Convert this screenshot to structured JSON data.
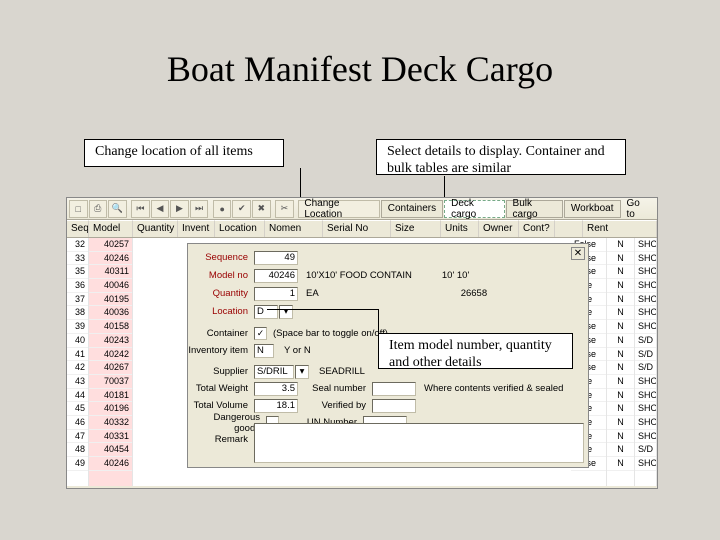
{
  "title": "Boat Manifest Deck Cargo",
  "callouts": {
    "change_location": "Change location of all items",
    "select_details": "Select details to display. Container and bulk tables are similar",
    "item_details": "Item model number, quantity and other details"
  },
  "toolbar": {
    "change_location_btn": "Change Location",
    "tabs": [
      "Containers",
      "Deck cargo",
      "Bulk cargo",
      "Workboat"
    ],
    "goto": "Go to"
  },
  "grid": {
    "headers": [
      "Seq",
      "Model",
      "Quantity",
      "Invent",
      "Location",
      "Nomen",
      "Serial No",
      "Size",
      "Units",
      "Owner",
      "Cont?",
      "",
      "Rent"
    ],
    "rows": [
      {
        "seq": "32",
        "model": "40257",
        "cont": "False",
        "own": "N",
        "rent": "SHO"
      },
      {
        "seq": "33",
        "model": "40246",
        "cont": "False",
        "own": "N",
        "rent": "SHO"
      },
      {
        "seq": "35",
        "model": "40311",
        "cont": "False",
        "own": "N",
        "rent": "SHO"
      },
      {
        "seq": "36",
        "model": "40046",
        "cont": "True",
        "own": "N",
        "rent": "SHO"
      },
      {
        "seq": "37",
        "model": "40195",
        "cont": "True",
        "own": "N",
        "rent": "SHO"
      },
      {
        "seq": "38",
        "model": "40036",
        "cont": "True",
        "own": "N",
        "rent": "SHO"
      },
      {
        "seq": "39",
        "model": "40158",
        "cont": "False",
        "own": "N",
        "rent": "SHO"
      },
      {
        "seq": "40",
        "model": "40243",
        "cont": "False",
        "own": "N",
        "rent": "S/D"
      },
      {
        "seq": "41",
        "model": "40242",
        "cont": "False",
        "own": "N",
        "rent": "S/D"
      },
      {
        "seq": "42",
        "model": "40267",
        "cont": "False",
        "own": "N",
        "rent": "S/D"
      },
      {
        "seq": "43",
        "model": "70037",
        "cont": "True",
        "own": "N",
        "rent": "SHO"
      },
      {
        "seq": "44",
        "model": "40181",
        "cont": "True",
        "own": "N",
        "rent": "SHO"
      },
      {
        "seq": "45",
        "model": "40196",
        "cont": "True",
        "own": "N",
        "rent": "SHO"
      },
      {
        "seq": "46",
        "model": "40332",
        "cont": "True",
        "own": "N",
        "rent": "SHO"
      },
      {
        "seq": "47",
        "model": "40331",
        "cont": "True",
        "own": "N",
        "rent": "SHO"
      },
      {
        "seq": "48",
        "model": "40454",
        "cont": "True",
        "own": "N",
        "rent": "S/D"
      },
      {
        "seq": "49",
        "model": "40246",
        "cont": "False",
        "own": "N",
        "rent": "SHO"
      }
    ]
  },
  "detail": {
    "sequence_label": "Sequence",
    "sequence_value": "49",
    "modelno_label": "Model no",
    "modelno_value": "40246",
    "modelno_desc": "10'X10' FOOD CONTAIN",
    "modelno_dims": "10'  10'",
    "quantity_label": "Quantity",
    "quantity_value": "1",
    "quantity_unit": "EA",
    "quantity_num": "26658",
    "location_label": "Location",
    "location_value": "D",
    "container_label": "Container",
    "container_checked": "✓",
    "container_hint": "(Space bar to toggle on/off)",
    "inventory_label": "Inventory item",
    "inventory_value": "N",
    "inventory_hint": "Y or N",
    "supplier_label": "Supplier",
    "supplier_value": "S/DRIL",
    "supplier_name": "SEADRILL",
    "totalweight_label": "Total Weight",
    "totalweight_value": "3.5",
    "totalvolume_label": "Total Volume",
    "totalvolume_value": "18.1",
    "sealno_label": "Seal number",
    "sealno_hint": "Where contents verified & sealed",
    "verifiedby_label": "Verified by",
    "dangerous_label": "Dangerous goods",
    "unno_label": "UN Number",
    "remark_label": "Remark"
  }
}
